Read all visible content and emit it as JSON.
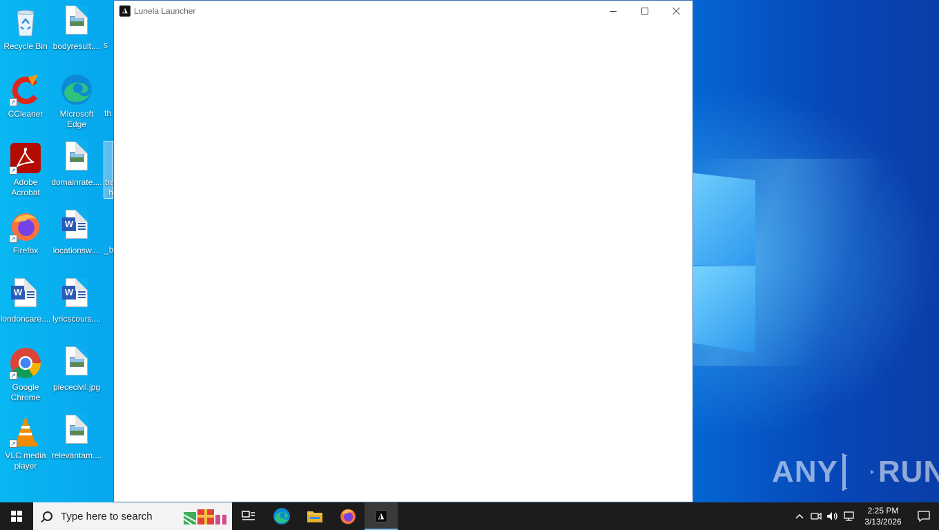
{
  "desktop": {
    "icons": [
      {
        "label": "Recycle Bin",
        "icon": "recycle-bin-icon"
      },
      {
        "label": "bodyresult....",
        "icon": "image-file-icon"
      },
      {
        "label": "CCleaner",
        "icon": "ccleaner-icon"
      },
      {
        "label": "Microsoft Edge",
        "icon": "edge-icon"
      },
      {
        "label": "Adobe Acrobat",
        "icon": "acrobat-icon"
      },
      {
        "label": "domainrate....",
        "icon": "image-file-icon"
      },
      {
        "label": "Firefox",
        "icon": "firefox-icon"
      },
      {
        "label": "locationsw....",
        "icon": "word-doc-icon"
      },
      {
        "label": "londoncare....",
        "icon": "word-doc-icon"
      },
      {
        "label": "lyricscours....",
        "icon": "word-doc-icon"
      },
      {
        "label": "Google Chrome",
        "icon": "chrome-icon"
      },
      {
        "label": "piececivil.jpg",
        "icon": "image-file-icon"
      },
      {
        "label": "VLC media player",
        "icon": "vlc-icon"
      },
      {
        "label": "relevantam....",
        "icon": "image-file-icon"
      }
    ],
    "partial_labels": [
      "s",
      "th",
      "tra",
      "h",
      "_b"
    ]
  },
  "window": {
    "title": "Lunela Launcher",
    "app_icon_glyph": "◮",
    "minimize_icon": "minimize-icon",
    "maximize_icon": "maximize-icon",
    "close_icon": "close-icon"
  },
  "watermark": {
    "left": "ANY",
    "right": "RUN"
  },
  "taskbar": {
    "search_placeholder": "Type here to search",
    "apps": [
      "task-view-icon",
      "edge-icon",
      "file-explorer-icon",
      "firefox-icon",
      "lunela-launcher-icon"
    ],
    "clock_time": "2:25 PM",
    "clock_date": "3/13/2026"
  }
}
